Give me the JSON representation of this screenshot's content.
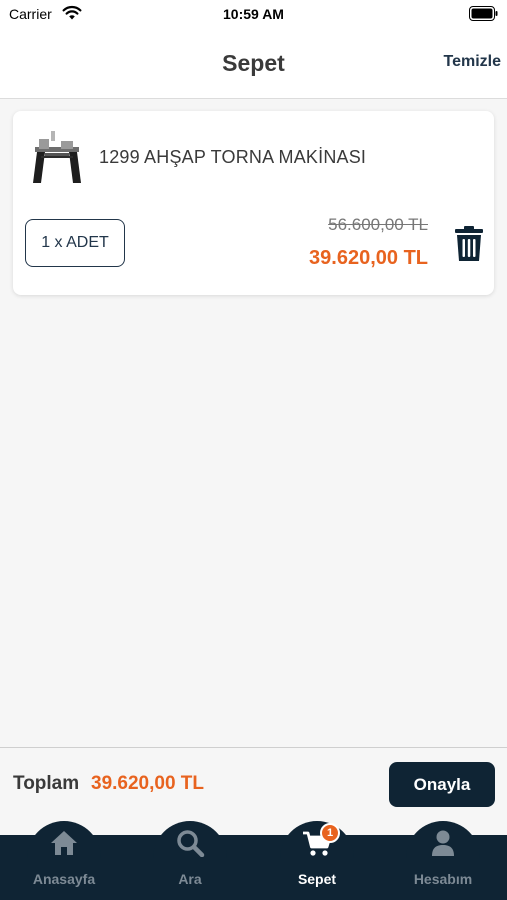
{
  "status_bar": {
    "carrier": "Carrier",
    "time": "10:59 AM"
  },
  "header": {
    "title": "Sepet",
    "clear_label": "Temizle"
  },
  "cart": {
    "items": [
      {
        "name": "1299 AHŞAP TORNA MAKİNASI",
        "quantity_label": "1 x ADET",
        "old_price": "56.600,00 TL",
        "new_price": "39.620,00 TL"
      }
    ]
  },
  "summary": {
    "total_label": "Toplam",
    "total_value": "39.620,00 TL",
    "confirm_label": "Onayla"
  },
  "tabs": [
    {
      "label": "Anasayfa",
      "icon": "home-icon",
      "active": false
    },
    {
      "label": "Ara",
      "icon": "search-icon",
      "active": false
    },
    {
      "label": "Sepet",
      "icon": "cart-icon",
      "active": true,
      "badge": "1"
    },
    {
      "label": "Hesabım",
      "icon": "user-icon",
      "active": false
    }
  ],
  "colors": {
    "accent": "#e8631f",
    "navy": "#0f2434",
    "tab_inactive": "#7d8a95"
  }
}
